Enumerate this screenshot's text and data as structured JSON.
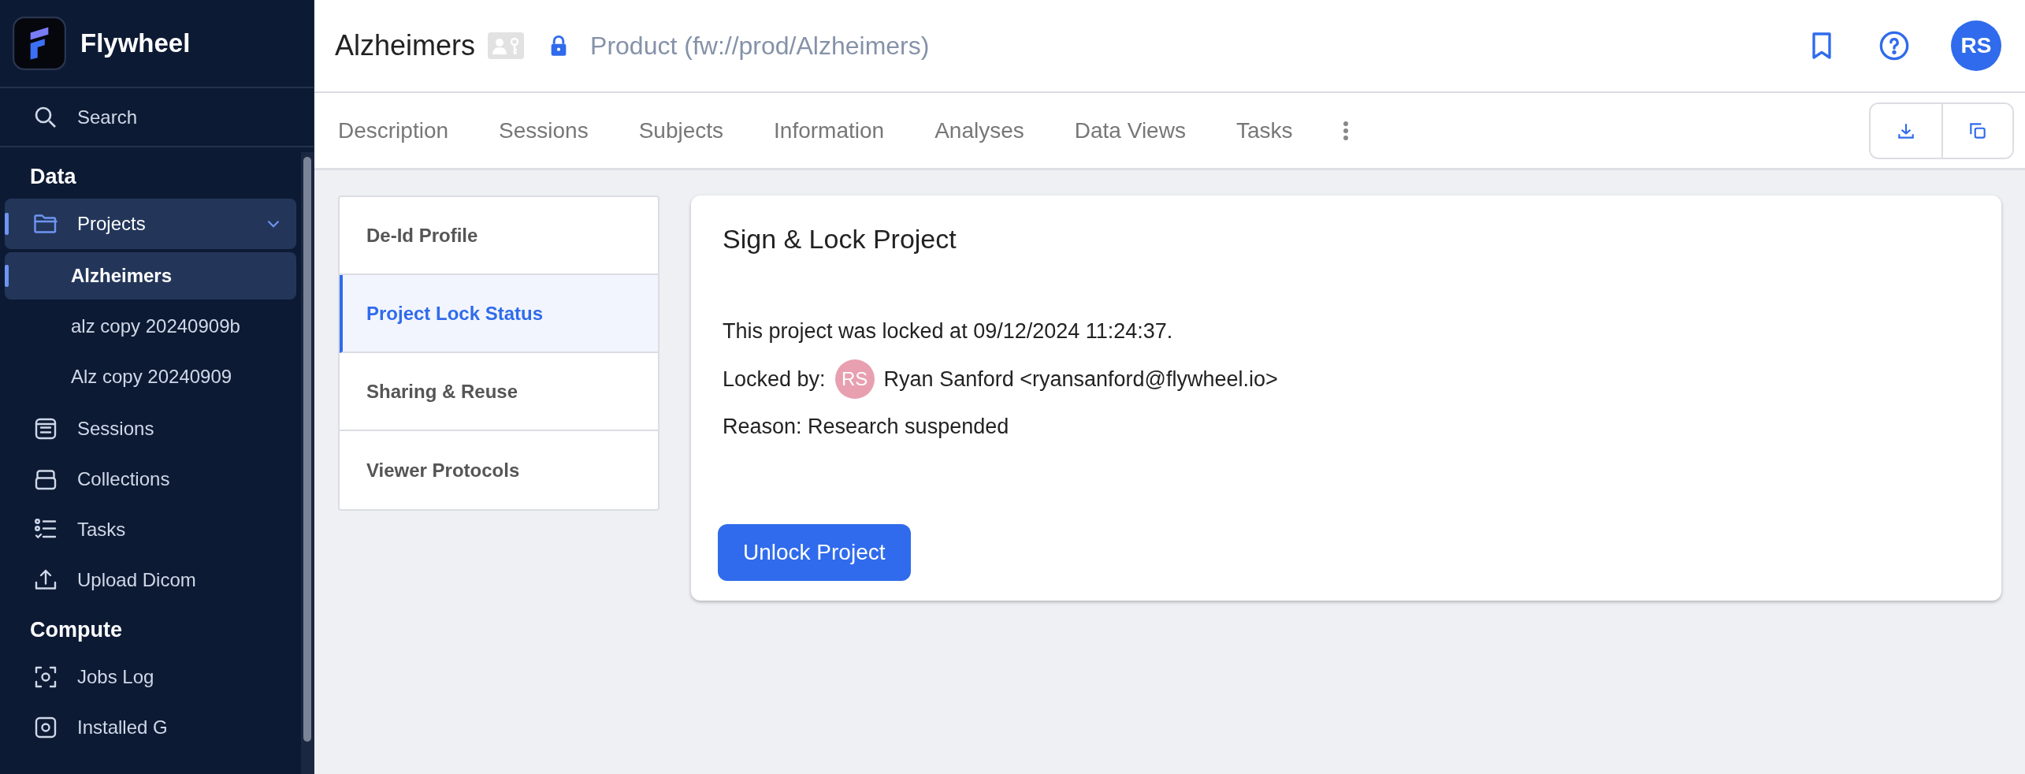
{
  "app": {
    "name": "Flywheel"
  },
  "sidebar": {
    "search": "Search",
    "sections": [
      {
        "title": "Data",
        "items": [
          {
            "label": "Projects",
            "expanded": true,
            "selected": true,
            "children": [
              {
                "label": "Alzheimers",
                "selected": true
              },
              {
                "label": "alz copy 20240909b",
                "selected": false
              },
              {
                "label": "Alz copy 20240909",
                "selected": false
              }
            ]
          },
          {
            "label": "Sessions",
            "selected": false
          },
          {
            "label": "Collections",
            "selected": false
          },
          {
            "label": "Tasks",
            "selected": false
          },
          {
            "label": "Upload Dicom",
            "selected": false
          }
        ]
      },
      {
        "title": "Compute",
        "items": [
          {
            "label": "Jobs Log",
            "selected": false
          },
          {
            "label": "Installed G",
            "selected": false
          }
        ]
      }
    ]
  },
  "header": {
    "title": "Alzheimers",
    "locked": true,
    "path": "Product (fw://prod/Alzheimers)",
    "avatar": "RS"
  },
  "tabs": [
    {
      "label": "Description",
      "selected": false
    },
    {
      "label": "Sessions",
      "selected": false
    },
    {
      "label": "Subjects",
      "selected": false
    },
    {
      "label": "Information",
      "selected": false
    },
    {
      "label": "Analyses",
      "selected": false
    },
    {
      "label": "Data Views",
      "selected": false
    },
    {
      "label": "Tasks",
      "selected": false
    }
  ],
  "settings_menu": [
    {
      "label": "De-Id Profile",
      "selected": false
    },
    {
      "label": "Project Lock Status",
      "selected": true
    },
    {
      "label": "Sharing & Reuse",
      "selected": false
    },
    {
      "label": "Viewer Protocols",
      "selected": false
    }
  ],
  "lock_card": {
    "title": "Sign & Lock Project",
    "locked_at": "This project was locked at 09/12/2024 11:24:37.",
    "locked_by_label": "Locked by:",
    "user_initials": "RS",
    "user": "Ryan Sanford <ryansanford@flywheel.io>",
    "reason": "Reason: Research suspended",
    "button": "Unlock Project"
  }
}
